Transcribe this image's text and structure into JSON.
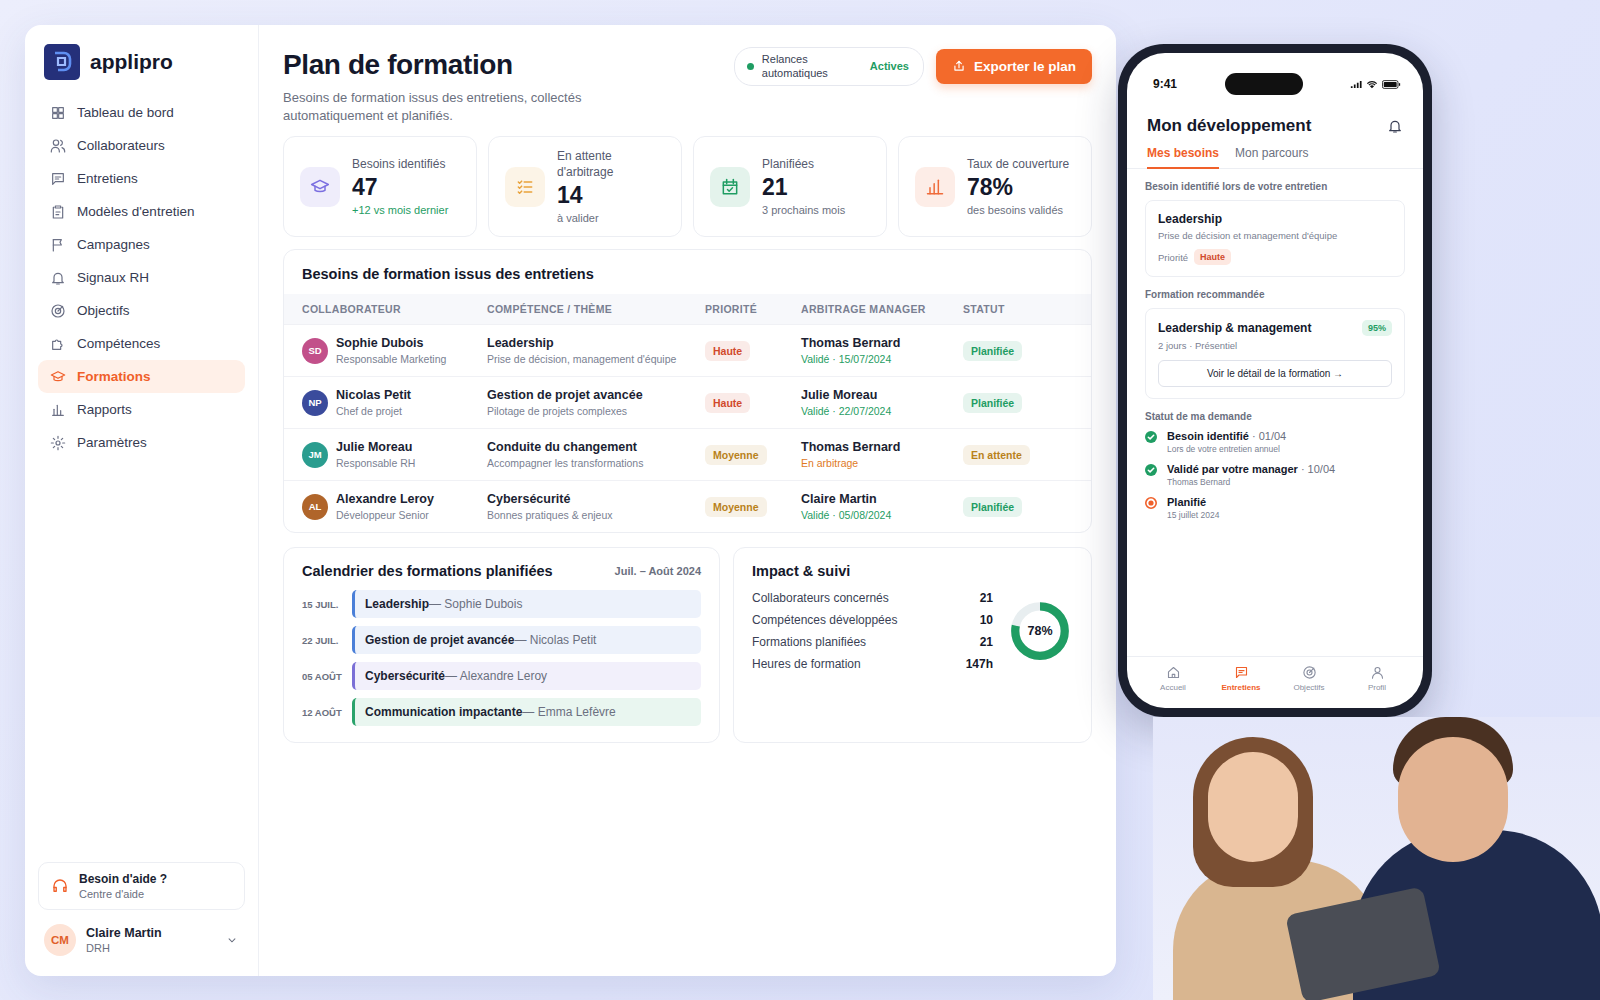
{
  "app": {
    "logo": "applipro"
  },
  "sidebar": {
    "items": [
      {
        "label": "Tableau de bord",
        "selected": false
      },
      {
        "label": "Collaborateurs",
        "selected": false
      },
      {
        "label": "Entretiens",
        "selected": false
      },
      {
        "label": "Modèles d'entretien",
        "selected": false
      },
      {
        "label": "Campagnes",
        "selected": false
      },
      {
        "label": "Signaux RH",
        "selected": false
      },
      {
        "label": "Objectifs",
        "selected": false
      },
      {
        "label": "Compétences",
        "selected": false
      },
      {
        "label": "Formations",
        "selected": true
      },
      {
        "label": "Rapports",
        "selected": false
      },
      {
        "label": "Paramètres",
        "selected": false
      }
    ]
  },
  "help": {
    "title": "Besoin d'aide ?",
    "subtitle": "Centre d'aide"
  },
  "user": {
    "initials": "CM",
    "name": "Claire Martin",
    "role": "DRH"
  },
  "header": {
    "title": "Plan de formation",
    "subtitle": "Besoins de formation issus des entretiens, collectés automatiquement et planifiés.",
    "reminders": {
      "label": "Relances automatiques",
      "state": "Actives",
      "on": true
    },
    "export_button": "Exporter le plan"
  },
  "stats": [
    {
      "label": "Besoins identifiés",
      "value": "47",
      "note": "+12 vs mois dernier",
      "positive": true,
      "color": "#7b6fe0"
    },
    {
      "label": "En attente d'arbitrage",
      "value": "14",
      "note": "à valider",
      "positive": false,
      "color": "#e9a23b"
    },
    {
      "label": "Planifiées",
      "value": "21",
      "note": "3 prochains mois",
      "positive": false,
      "color": "#1f9d63"
    },
    {
      "label": "Taux de couverture",
      "value": "78%",
      "note": "des besoins validés",
      "positive": false,
      "color": "#ef6b3a"
    }
  ],
  "table": {
    "title": "Besoins de formation issus des entretiens",
    "columns": [
      "COLLABORATEUR",
      "COMPÉTENCE / THÈME",
      "PRIORITÉ",
      "ARBITRAGE MANAGER",
      "STATUT"
    ],
    "rows": [
      {
        "initials": "SD",
        "avatar_color": "#c2508a",
        "name": "Sophie Dubois",
        "role": "Responsable Marketing",
        "skill": "Leadership",
        "skill_detail": "Prise de décision, management d'équipe",
        "priority": {
          "label": "Haute",
          "color": "#d1492b"
        },
        "manager": "Thomas Bernard",
        "decision": {
          "label": "Validé · 15/07/2024",
          "color": "#1f9d63"
        },
        "status": {
          "label": "Planifiée",
          "color": "#1f9d63"
        }
      },
      {
        "initials": "NP",
        "avatar_color": "#3a4b9c",
        "name": "Nicolas Petit",
        "role": "Chef de projet",
        "skill": "Gestion de projet avancée",
        "skill_detail": "Pilotage de projets complexes",
        "priority": {
          "label": "Haute",
          "color": "#d1492b"
        },
        "manager": "Julie Moreau",
        "decision": {
          "label": "Validé · 22/07/2024",
          "color": "#1f9d63"
        },
        "status": {
          "label": "Planifiée",
          "color": "#1f9d63"
        }
      },
      {
        "initials": "JM",
        "avatar_color": "#2a9d8f",
        "name": "Julie Moreau",
        "role": "Responsable RH",
        "skill": "Conduite du changement",
        "skill_detail": "Accompagner les transformations",
        "priority": {
          "label": "Moyenne",
          "color": "#b9811a"
        },
        "manager": "Thomas Bernard",
        "decision": {
          "label": "En arbitrage",
          "color": "#e07a1f"
        },
        "status": {
          "label": "En attente",
          "color": "#b9811a"
        }
      },
      {
        "initials": "AL",
        "avatar_color": "#b0652a",
        "name": "Alexandre Leroy",
        "role": "Développeur Senior",
        "skill": "Cybersécurité",
        "skill_detail": "Bonnes pratiques & enjeux",
        "priority": {
          "label": "Moyenne",
          "color": "#b9811a"
        },
        "manager": "Claire Martin",
        "decision": {
          "label": "Validé · 05/08/2024",
          "color": "#1f9d63"
        },
        "status": {
          "label": "Planifiée",
          "color": "#1f9d63"
        }
      }
    ]
  },
  "calendar": {
    "title": "Calendrier des formations planifiées",
    "range": "Juil. – Août 2024",
    "separator": "—",
    "events": [
      {
        "date": "15 JUIL.",
        "course": "Leadership",
        "person": "Sophie Dubois",
        "color": "#4a7fd8"
      },
      {
        "date": "22 JUIL.",
        "course": "Gestion de projet avancée",
        "person": "Nicolas Petit",
        "color": "#4a7fd8"
      },
      {
        "date": "05 AOÛT",
        "course": "Cybersécurité",
        "person": "Alexandre Leroy",
        "color": "#7b6fd6"
      },
      {
        "date": "12 AOÛT",
        "course": "Communication impactante",
        "person": "Emma Lefèvre",
        "color": "#2aa36b"
      }
    ]
  },
  "impact": {
    "title": "Impact & suivi",
    "metrics": [
      {
        "label": "Collaborateurs concernés",
        "value": "21"
      },
      {
        "label": "Compétences développées",
        "value": "10"
      },
      {
        "label": "Formations planifiées",
        "value": "21"
      },
      {
        "label": "Heures de formation",
        "value": "147h"
      }
    ],
    "coverage": {
      "label": "78%",
      "level": 0.78
    }
  },
  "phone": {
    "time": "9:41",
    "title": "Mon développement",
    "tabs": [
      {
        "label": "Mes besoins",
        "selected": true
      },
      {
        "label": "Mon parcours",
        "selected": false
      }
    ],
    "need": {
      "section": "Besoin identifié lors de votre entretien",
      "title": "Leadership",
      "detail": "Prise de décision et management d'équipe",
      "priority_label": "Priorité",
      "priority": "Haute"
    },
    "recommendation": {
      "section": "Formation recommandée",
      "title": "Leadership & management",
      "match": "95%",
      "detail": "2 jours · Présentiel",
      "button": "Voir le détail de la formation →"
    },
    "request": {
      "section": "Statut de ma demande",
      "steps": [
        {
          "title": "Besoin identifié",
          "date": "· 01/04",
          "detail": "Lors de votre entretien annuel",
          "done": true,
          "color": "#1f9d63"
        },
        {
          "title": "Validé par votre manager",
          "date": "· 10/04",
          "detail": "Thomas Bernard",
          "done": true,
          "color": "#1f9d63"
        },
        {
          "title": "Planifié",
          "date": "",
          "detail": "15 juillet 2024",
          "done": false,
          "color": "#f0602a"
        }
      ]
    },
    "nav": [
      {
        "label": "Accueil",
        "selected": false
      },
      {
        "label": "Entretiens",
        "selected": true
      },
      {
        "label": "Objectifs",
        "selected": false
      },
      {
        "label": "Profil",
        "selected": false
      }
    ]
  }
}
